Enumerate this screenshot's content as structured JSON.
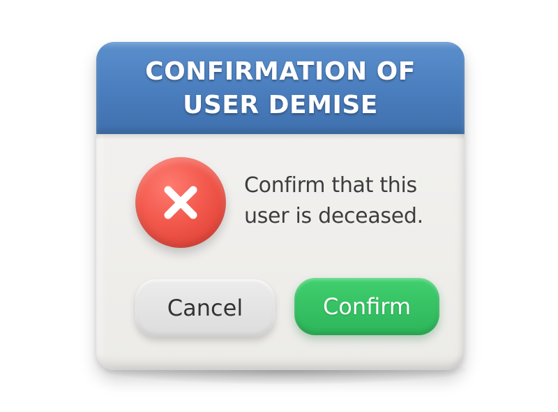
{
  "dialog": {
    "title": "CONFIRMATION OF USER DEMISE",
    "message": "Confirm that this user is deceased.",
    "icon": "error-x-icon",
    "buttons": {
      "cancel_label": "Cancel",
      "confirm_label": "Confirm"
    }
  },
  "colors": {
    "header": "#4a7dbd",
    "error_badge": "#f2584c",
    "confirm_button": "#34c060",
    "cancel_button": "#e4e4e4",
    "message_text": "#3d3d3d"
  }
}
